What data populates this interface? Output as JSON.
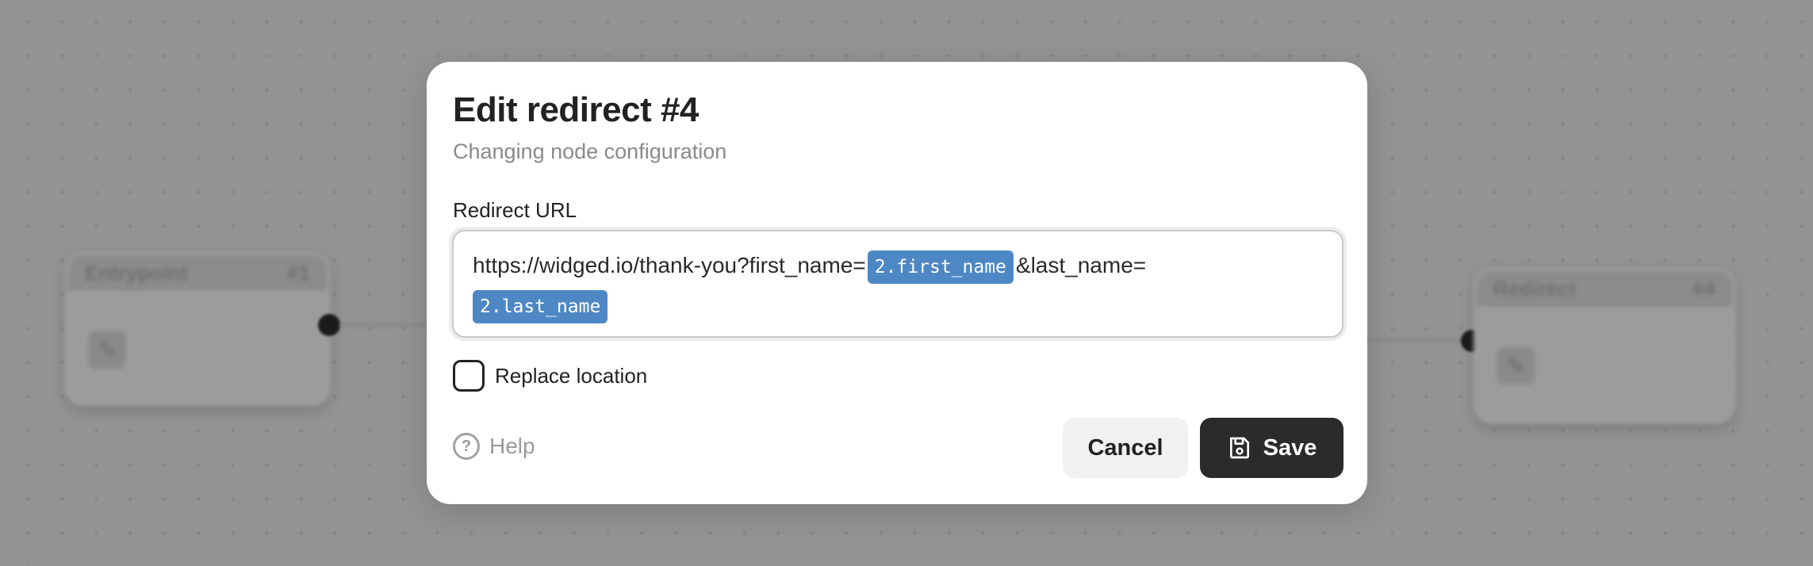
{
  "background": {
    "node_left": {
      "title": "Entrypoint",
      "badge": "#1"
    },
    "node_right": {
      "title": "Redirect",
      "badge": "#4"
    }
  },
  "modal": {
    "title": "Edit redirect #4",
    "subtitle": "Changing node configuration",
    "field_label": "Redirect URL",
    "url_parts": {
      "text1": "https://widged.io/thank-you?first_name=",
      "tag1": "2.first_name",
      "text2": "&last_name=",
      "tag2": "2.last_name"
    },
    "replace_location_label": "Replace location",
    "replace_location_checked": false,
    "help_label": "Help",
    "cancel_label": "Cancel",
    "save_label": "Save"
  },
  "colors": {
    "tag_bg": "#4e88c4",
    "save_bg": "#2b2b2b",
    "cancel_bg": "#f1f1f1"
  },
  "icons": {
    "help": "question-circle-icon",
    "save": "floppy-disk-icon",
    "node": "pencil-edit-icon"
  }
}
